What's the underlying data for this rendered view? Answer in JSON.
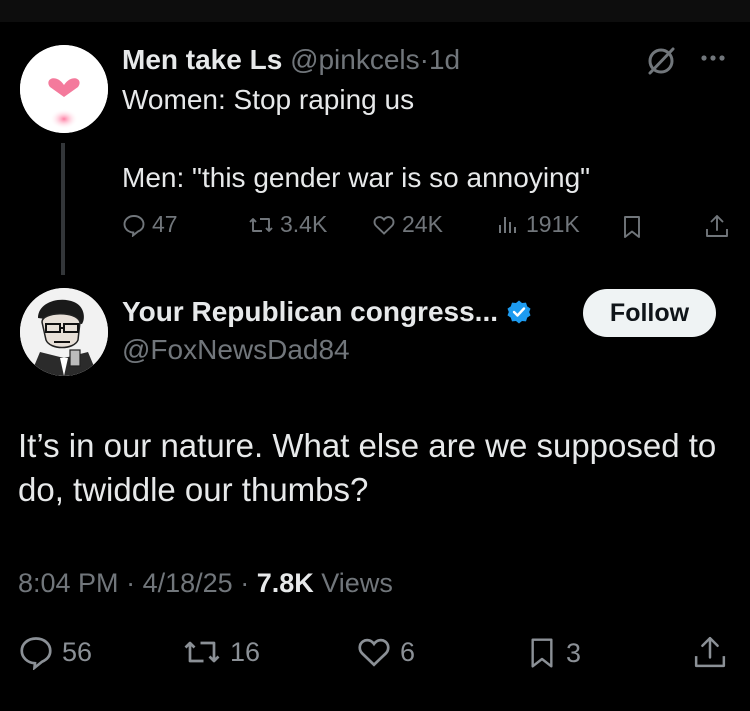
{
  "quoted_tweet": {
    "display_name": "Men take Ls",
    "handle": "@pinkcels",
    "separator": "·",
    "age": "1d",
    "line1": "Women: Stop raping us",
    "line2": "Men: \"this gender war is so annoying\"",
    "metrics": {
      "replies": "47",
      "reposts": "3.4K",
      "likes": "24K",
      "views": "191K"
    }
  },
  "main_tweet": {
    "display_name": "Your Republican congress...",
    "handle": "@FoxNewsDad84",
    "follow_label": "Follow",
    "body": "It’s in our nature. What else are we supposed to do, twiddle our thumbs?",
    "time": "8:04 PM",
    "sep": "·",
    "date": "4/18/25",
    "views_count": "7.8K",
    "views_label": "Views",
    "metrics": {
      "replies": "56",
      "reposts": "16",
      "likes": "6",
      "bookmarks": "3"
    }
  },
  "colors": {
    "background": "#000000",
    "text": "#e7e9ea",
    "muted": "#71767b",
    "verified": "#1d9bf0",
    "follow_bg": "#eff3f4"
  },
  "icons": [
    "grok-icon",
    "more-icon",
    "reply-icon",
    "repost-icon",
    "like-icon",
    "views-icon",
    "bookmark-icon",
    "share-icon",
    "verified-badge-icon"
  ]
}
